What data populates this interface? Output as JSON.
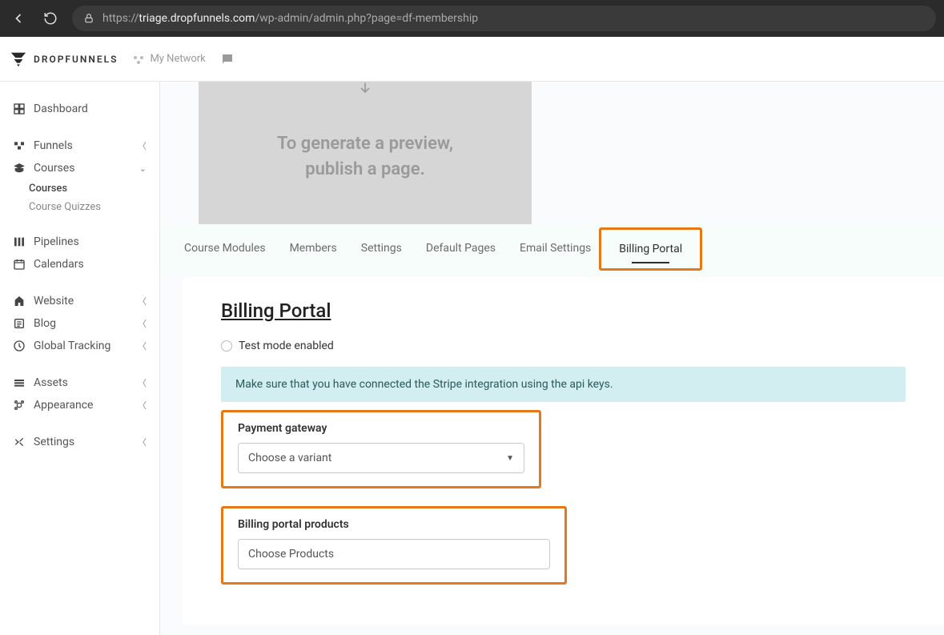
{
  "browser": {
    "url_prefix": "https://",
    "url_domain": "triage.dropfunnels.com",
    "url_path": "/wp-admin/admin.php?page=df-membership"
  },
  "header": {
    "brand": "DROPFUNNELS",
    "my_network": "My Network"
  },
  "sidebar": {
    "dashboard": "Dashboard",
    "funnels": "Funnels",
    "courses": "Courses",
    "courses_sub": {
      "courses": "Courses",
      "quizzes": "Course Quizzes"
    },
    "pipelines": "Pipelines",
    "calendars": "Calendars",
    "website": "Website",
    "blog": "Blog",
    "global_tracking": "Global Tracking",
    "assets": "Assets",
    "appearance": "Appearance",
    "settings": "Settings"
  },
  "preview": {
    "line1": "To generate a preview,",
    "line2": "publish a page."
  },
  "tabs": {
    "modules": "Course Modules",
    "members": "Members",
    "settings": "Settings",
    "default_pages": "Default Pages",
    "email_settings": "Email Settings",
    "billing_portal": "Billing Portal"
  },
  "panel": {
    "title": "Billing Portal",
    "test_mode": "Test mode enabled",
    "info": "Make sure that you have connected the Stripe integration using the api keys.",
    "gateway_label": "Payment gateway",
    "gateway_placeholder": "Choose a variant",
    "products_label": "Billing portal products",
    "products_placeholder": "Choose Products"
  }
}
